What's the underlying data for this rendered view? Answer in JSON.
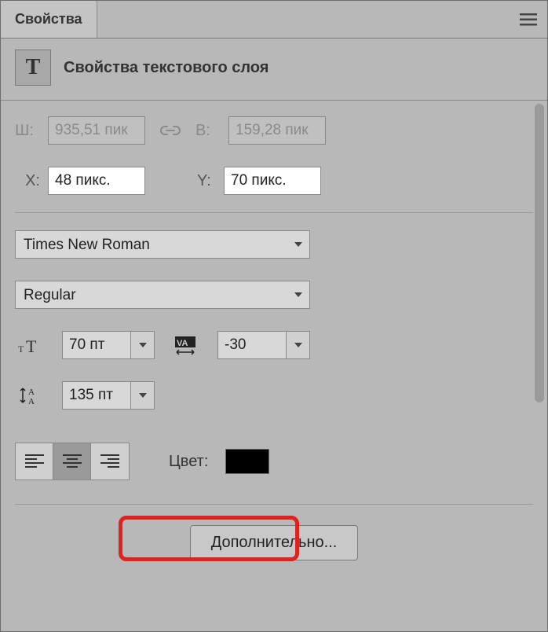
{
  "titlebar": {
    "tab": "Свойства"
  },
  "header": {
    "badge": "T",
    "title": "Свойства текстового слоя"
  },
  "dims": {
    "w_label": "Ш:",
    "w_value": "935,51 пик",
    "h_label": "В:",
    "h_value": "159,28 пик",
    "x_label": "X:",
    "x_value": "48 пикс.",
    "y_label": "Y:",
    "y_value": "70 пикс."
  },
  "font": {
    "family": "Times New Roman",
    "style": "Regular",
    "size": "70 пт",
    "tracking": "-30",
    "leading": "135 пт"
  },
  "color": {
    "label": "Цвет:",
    "value": "#000000"
  },
  "more": {
    "label": "Дополнительно..."
  }
}
